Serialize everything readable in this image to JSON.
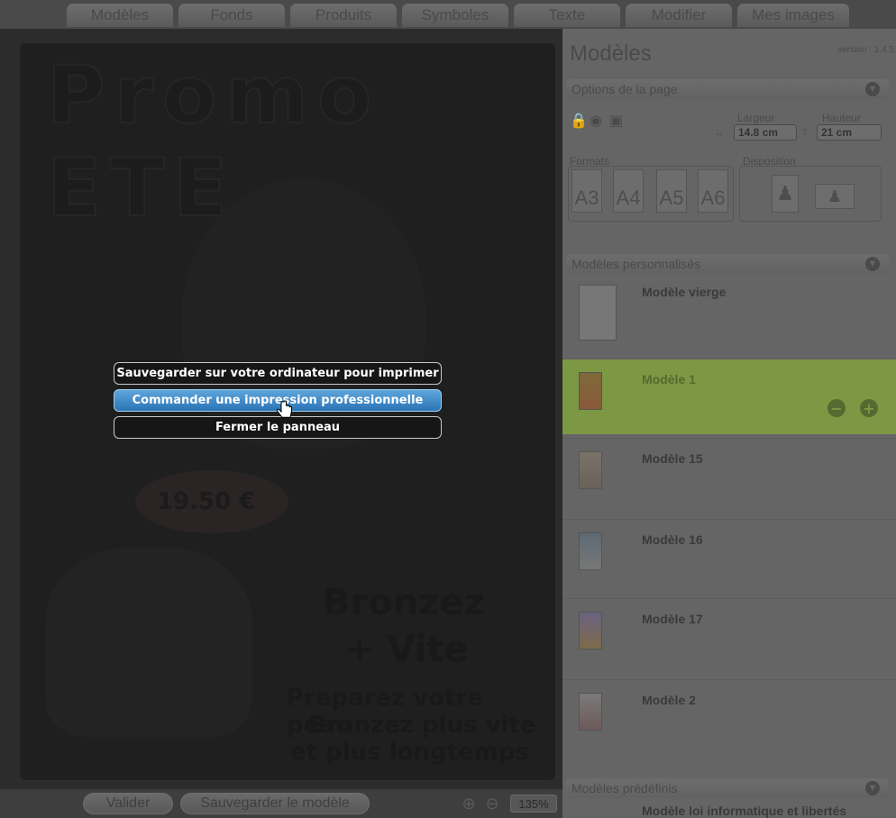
{
  "tabs": [
    "Modèles",
    "Fonds",
    "Produits",
    "Symboles",
    "Texte",
    "Modifier",
    "Mes images"
  ],
  "canvas": {
    "title": "Promo ETE",
    "price": "19.50 €",
    "headline1": "Bronzez",
    "headline2": "+ Vite",
    "body1": "Preparez votre peau",
    "body2": "Bronzez plus vite",
    "body3": "et plus longtemps"
  },
  "popup": {
    "save_local": "Sauvegarder sur votre ordinateur pour imprimer",
    "order_print": "Commander une impression professionnelle",
    "close_panel": "Fermer le panneau"
  },
  "bottom": {
    "validate": "Valider",
    "save_model": "Sauvegarder le modèle",
    "zoom_level": "135%"
  },
  "panel": {
    "title": "Modèles",
    "version": "version : 1.4.5",
    "page_options": {
      "header": "Options de la page",
      "width_label": "Largeur",
      "height_label": "Hauteur",
      "width_value": "14.8 cm",
      "height_value": "21 cm",
      "formats_label": "Formats",
      "disposition_label": "Disposition",
      "formats": [
        "A3",
        "A4",
        "A5",
        "A6"
      ]
    },
    "custom_models": {
      "header": "Modèles personnalisés",
      "items": [
        {
          "label": "Modèle vierge",
          "selected": false
        },
        {
          "label": "Modèle 1",
          "selected": true
        },
        {
          "label": "Modèle 15",
          "selected": false
        },
        {
          "label": "Modèle 16",
          "selected": false
        },
        {
          "label": "Modèle 17",
          "selected": false
        },
        {
          "label": "Modèle 2",
          "selected": false
        }
      ]
    },
    "predefined_models": {
      "header": "Modèles prédéfinis",
      "first_item": "Modèle loi informatique et libertés"
    }
  },
  "colors": {
    "selected_row": "#7c9845",
    "active_button": "#2a73b4"
  }
}
